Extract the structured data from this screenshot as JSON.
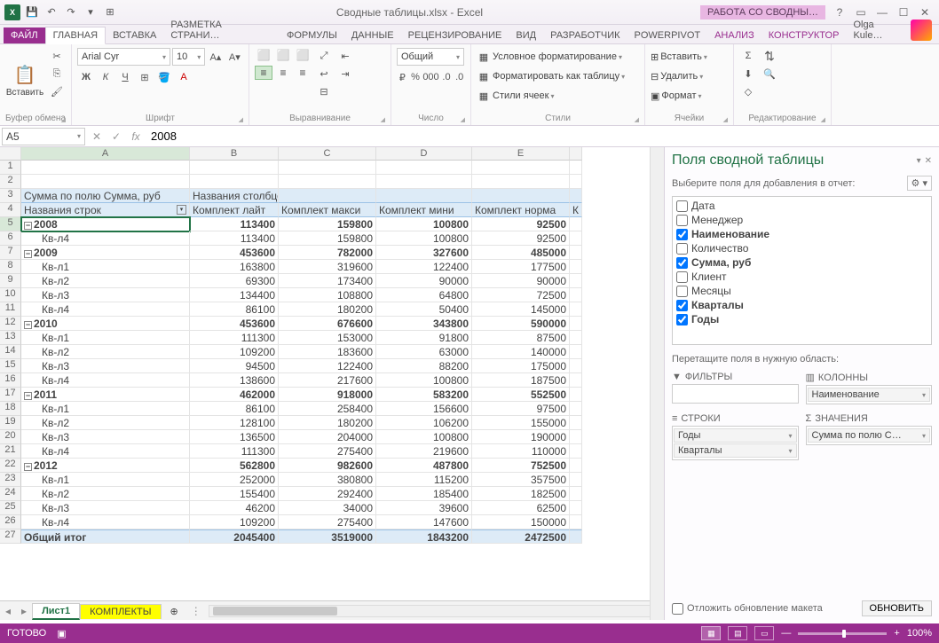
{
  "titlebar": {
    "filename": "Сводные таблицы.xlsx - Excel",
    "contextual": "РАБОТА СО СВОДНЫ…"
  },
  "tabs": {
    "file": "ФАЙЛ",
    "items": [
      "ГЛАВНАЯ",
      "ВСТАВКА",
      "РАЗМЕТКА СТРАНИ…",
      "ФОРМУЛЫ",
      "ДАННЫЕ",
      "РЕЦЕНЗИРОВАНИЕ",
      "ВИД",
      "РАЗРАБОТЧИК",
      "POWERPIVOT"
    ],
    "ctx": [
      "АНАЛИЗ",
      "КОНСТРУКТОР"
    ],
    "user": "Olga Kule…"
  },
  "ribbon": {
    "clipboard": {
      "label": "Буфер обмена",
      "paste": "Вставить"
    },
    "font": {
      "label": "Шрифт",
      "name": "Arial Cyr",
      "size": "10"
    },
    "align": {
      "label": "Выравнивание"
    },
    "number": {
      "label": "Число",
      "format": "Общий"
    },
    "styles": {
      "label": "Стили",
      "cond": "Условное форматирование",
      "fmt": "Форматировать как таблицу",
      "cell": "Стили ячеек"
    },
    "cells": {
      "label": "Ячейки",
      "insert": "Вставить",
      "delete": "Удалить",
      "format": "Формат"
    },
    "editing": {
      "label": "Редактирование"
    }
  },
  "namebox": "A5",
  "formula": "2008",
  "columns": [
    "",
    "A",
    "B",
    "C",
    "D",
    "E",
    ""
  ],
  "pivot": {
    "sumfield": "Сумма по полю Сумма, руб",
    "collabels": "Названия столбцов",
    "rowlabels": "Названия строк",
    "cols": [
      "Комплект лайт",
      "Комплект макси",
      "Комплект мини",
      "Комплект норма",
      "К"
    ],
    "grandtotal": "Общий итог"
  },
  "rows": [
    {
      "n": 5,
      "type": "year",
      "label": "2008",
      "v": [
        113400,
        159800,
        100800,
        92500
      ]
    },
    {
      "n": 6,
      "type": "q",
      "label": "Кв-л4",
      "v": [
        113400,
        159800,
        100800,
        92500
      ]
    },
    {
      "n": 7,
      "type": "year",
      "label": "2009",
      "v": [
        453600,
        782000,
        327600,
        485000
      ]
    },
    {
      "n": 8,
      "type": "q",
      "label": "Кв-л1",
      "v": [
        163800,
        319600,
        122400,
        177500
      ]
    },
    {
      "n": 9,
      "type": "q",
      "label": "Кв-л2",
      "v": [
        69300,
        173400,
        90000,
        90000
      ]
    },
    {
      "n": 10,
      "type": "q",
      "label": "Кв-л3",
      "v": [
        134400,
        108800,
        64800,
        72500
      ]
    },
    {
      "n": 11,
      "type": "q",
      "label": "Кв-л4",
      "v": [
        86100,
        180200,
        50400,
        145000
      ]
    },
    {
      "n": 12,
      "type": "year",
      "label": "2010",
      "v": [
        453600,
        676600,
        343800,
        590000
      ]
    },
    {
      "n": 13,
      "type": "q",
      "label": "Кв-л1",
      "v": [
        111300,
        153000,
        91800,
        87500
      ]
    },
    {
      "n": 14,
      "type": "q",
      "label": "Кв-л2",
      "v": [
        109200,
        183600,
        63000,
        140000
      ]
    },
    {
      "n": 15,
      "type": "q",
      "label": "Кв-л3",
      "v": [
        94500,
        122400,
        88200,
        175000
      ]
    },
    {
      "n": 16,
      "type": "q",
      "label": "Кв-л4",
      "v": [
        138600,
        217600,
        100800,
        187500
      ]
    },
    {
      "n": 17,
      "type": "year",
      "label": "2011",
      "v": [
        462000,
        918000,
        583200,
        552500
      ]
    },
    {
      "n": 18,
      "type": "q",
      "label": "Кв-л1",
      "v": [
        86100,
        258400,
        156600,
        97500
      ]
    },
    {
      "n": 19,
      "type": "q",
      "label": "Кв-л2",
      "v": [
        128100,
        180200,
        106200,
        155000
      ]
    },
    {
      "n": 20,
      "type": "q",
      "label": "Кв-л3",
      "v": [
        136500,
        204000,
        100800,
        190000
      ]
    },
    {
      "n": 21,
      "type": "q",
      "label": "Кв-л4",
      "v": [
        111300,
        275400,
        219600,
        110000
      ]
    },
    {
      "n": 22,
      "type": "year",
      "label": "2012",
      "v": [
        562800,
        982600,
        487800,
        752500
      ]
    },
    {
      "n": 23,
      "type": "q",
      "label": "Кв-л1",
      "v": [
        252000,
        380800,
        115200,
        357500
      ]
    },
    {
      "n": 24,
      "type": "q",
      "label": "Кв-л2",
      "v": [
        155400,
        292400,
        185400,
        182500
      ]
    },
    {
      "n": 25,
      "type": "q",
      "label": "Кв-л3",
      "v": [
        46200,
        34000,
        39600,
        62500
      ]
    },
    {
      "n": 26,
      "type": "q",
      "label": "Кв-л4",
      "v": [
        109200,
        275400,
        147600,
        150000
      ]
    }
  ],
  "grandtotals": [
    2045400,
    3519000,
    1843200,
    2472500
  ],
  "sheets": {
    "s1": "Лист1",
    "s2": "КОМПЛЕКТЫ"
  },
  "pane": {
    "title": "Поля сводной таблицы",
    "hint": "Выберите поля для добавления в отчет:",
    "fields": [
      {
        "name": "Дата",
        "checked": false
      },
      {
        "name": "Менеджер",
        "checked": false
      },
      {
        "name": "Наименование",
        "checked": true
      },
      {
        "name": "Количество",
        "checked": false
      },
      {
        "name": "Сумма, руб",
        "checked": true
      },
      {
        "name": "Клиент",
        "checked": false
      },
      {
        "name": "Месяцы",
        "checked": false
      },
      {
        "name": "Кварталы",
        "checked": true
      },
      {
        "name": "Годы",
        "checked": true
      }
    ],
    "areahint": "Перетащите поля в нужную область:",
    "areas": {
      "filters": "ФИЛЬТРЫ",
      "columns": "КОЛОННЫ",
      "rows": "СТРОКИ",
      "values": "ЗНАЧЕНИЯ",
      "col_items": [
        "Наименование"
      ],
      "row_items": [
        "Годы",
        "Кварталы"
      ],
      "val_items": [
        "Сумма по полю С…"
      ]
    },
    "defer": "Отложить обновление макета",
    "update": "ОБНОВИТЬ"
  },
  "status": {
    "ready": "ГОТОВО",
    "zoom": "100%"
  }
}
